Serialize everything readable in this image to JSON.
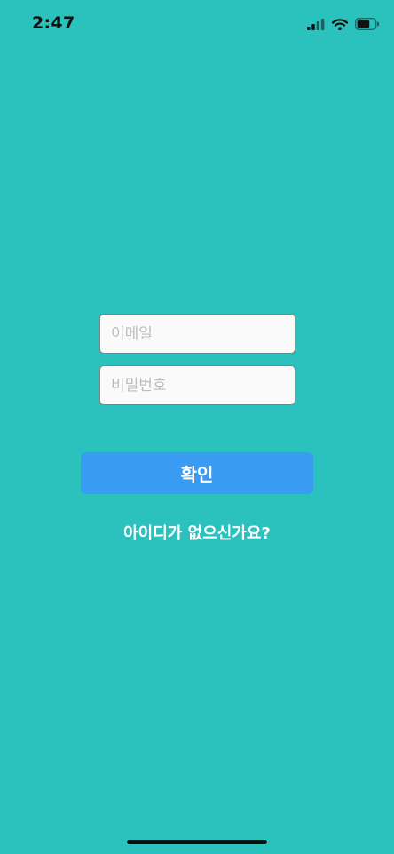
{
  "status_bar": {
    "time": "2:47",
    "icons": [
      "cellular-signal-icon",
      "wifi-icon",
      "battery-icon"
    ],
    "battery_level": 0.7
  },
  "login_form": {
    "email_placeholder": "이메일",
    "email_value": "",
    "password_placeholder": "비밀번호",
    "password_value": ""
  },
  "confirm_label": "확인",
  "signup_link": "아이디가 없으신가요?",
  "colors": {
    "background": "#2bc1bc",
    "button": "#3a9bf2",
    "field_background": "#fafafa",
    "field_border": "#7c8384",
    "placeholder": "#b9bcbf"
  }
}
